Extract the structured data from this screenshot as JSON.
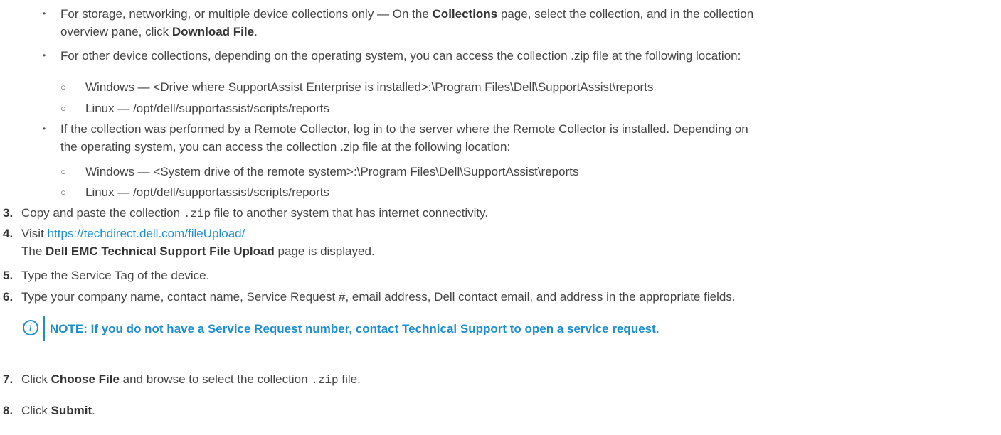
{
  "bullets": [
    {
      "pre": "For storage, networking, or multiple device collections only — On the ",
      "b1": "Collections",
      "mid": " page, select the collection, and in the collection",
      "line2_pre": "overview pane, click ",
      "b2": "Download File",
      "line2_post": "."
    },
    {
      "text": "For other device collections, depending on the operating system, you can access the collection .zip file at the following location:"
    },
    {
      "line1": "If the collection was performed by a Remote Collector, log in to the server where the Remote Collector is installed. Depending on",
      "line2": "the operating system, you can access the collection .zip file at the following location:"
    }
  ],
  "sub_a": [
    "Windows — <Drive where SupportAssist Enterprise is installed>:\\Program Files\\Dell\\SupportAssist\\reports",
    "Linux — /opt/dell/supportassist/scripts/reports"
  ],
  "sub_b": [
    "Windows — <System drive of the remote system>:\\Program Files\\Dell\\SupportAssist\\reports",
    "Linux — /opt/dell/supportassist/scripts/reports"
  ],
  "bullet_glyph": "•",
  "circle_glyph": "○",
  "steps": {
    "s3": {
      "num": "3.",
      "pre": "Copy and paste the collection ",
      "code": ".zip",
      "post": " file to another system that has internet connectivity."
    },
    "s4": {
      "num": "4.",
      "pre": "Visit ",
      "link": "https://techdirect.dell.com/fileUpload/",
      "line2_pre": "The ",
      "bold": "Dell EMC Technical Support File Upload",
      "line2_post": " page is displayed."
    },
    "s5": {
      "num": "5.",
      "text": "Type the Service Tag of the device."
    },
    "s6": {
      "num": "6.",
      "text": "Type your company name, contact name, Service Request #, email address, Dell contact email, and address in the appropriate fields."
    },
    "s7": {
      "num": "7.",
      "pre": "Click ",
      "bold": "Choose File",
      "mid": " and browse to select the collection ",
      "code": ".zip",
      "post": " file."
    },
    "s8": {
      "num": "8.",
      "pre": "Click ",
      "bold": "Submit",
      "post": "."
    }
  },
  "note": {
    "icon": "i",
    "text": "NOTE: If you do not have a Service Request number, contact Technical Support to open a service request."
  },
  "colors": {
    "text": "#444444",
    "link": "#1d8fd1",
    "note": "#1d8fd1"
  }
}
